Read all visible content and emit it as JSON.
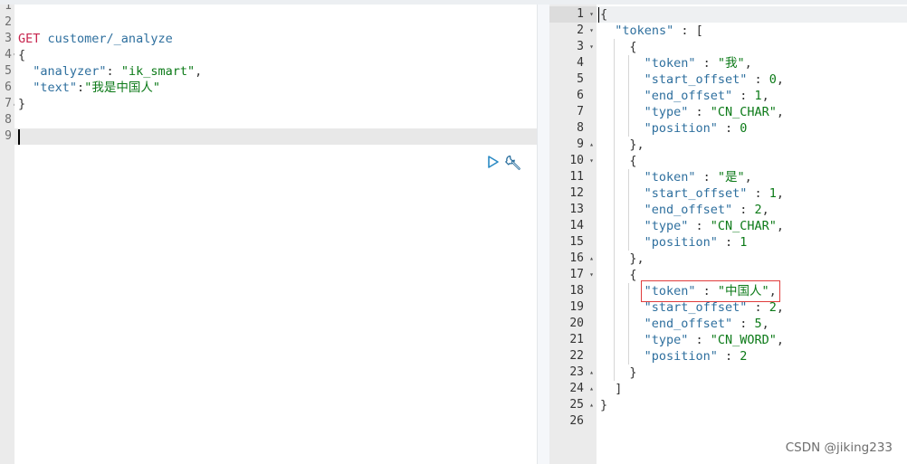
{
  "request": {
    "line_numbers": [
      "1",
      "2",
      "3",
      "4",
      "5",
      "6",
      "7",
      "8",
      "9"
    ],
    "lines": [
      {
        "n": 3,
        "parts": [
          [
            "method",
            "GET"
          ],
          [
            "punc",
            " "
          ],
          [
            "url",
            "customer/_analyze"
          ]
        ]
      },
      {
        "n": 4,
        "parts": [
          [
            "punc",
            "{"
          ]
        ]
      },
      {
        "n": 5,
        "parts": [
          [
            "punc",
            "  "
          ],
          [
            "key",
            "\"analyzer\""
          ],
          [
            "punc",
            ": "
          ],
          [
            "str",
            "\"ik_smart\""
          ],
          [
            "punc",
            ","
          ]
        ]
      },
      {
        "n": 6,
        "parts": [
          [
            "punc",
            "  "
          ],
          [
            "key",
            "\"text\""
          ],
          [
            "punc",
            ":"
          ],
          [
            "str",
            "\"我是中国人\""
          ]
        ]
      },
      {
        "n": 7,
        "parts": [
          [
            "punc",
            "}"
          ]
        ]
      }
    ],
    "active_line": 9,
    "fold_lines": [
      4,
      7
    ]
  },
  "toolbar": {
    "run_icon": "play-triangle-icon",
    "settings_icon": "wrench-icon"
  },
  "response": {
    "line_count": 26,
    "active_line": 1,
    "fold_down": [
      1,
      2,
      3,
      10,
      17
    ],
    "fold_up": [
      9,
      16,
      23,
      24,
      25
    ],
    "lines": [
      {
        "n": 1,
        "i": 0,
        "parts": [
          [
            "punc",
            "{"
          ]
        ]
      },
      {
        "n": 2,
        "i": 1,
        "parts": [
          [
            "key",
            "\"tokens\""
          ],
          [
            "punc",
            " : ["
          ]
        ]
      },
      {
        "n": 3,
        "i": 2,
        "parts": [
          [
            "punc",
            "{"
          ]
        ]
      },
      {
        "n": 4,
        "i": 3,
        "parts": [
          [
            "key",
            "\"token\""
          ],
          [
            "punc",
            " : "
          ],
          [
            "str",
            "\"我\""
          ],
          [
            "punc",
            ","
          ]
        ]
      },
      {
        "n": 5,
        "i": 3,
        "parts": [
          [
            "key",
            "\"start_offset\""
          ],
          [
            "punc",
            " : "
          ],
          [
            "num",
            "0"
          ],
          [
            "punc",
            ","
          ]
        ]
      },
      {
        "n": 6,
        "i": 3,
        "parts": [
          [
            "key",
            "\"end_offset\""
          ],
          [
            "punc",
            " : "
          ],
          [
            "num",
            "1"
          ],
          [
            "punc",
            ","
          ]
        ]
      },
      {
        "n": 7,
        "i": 3,
        "parts": [
          [
            "key",
            "\"type\""
          ],
          [
            "punc",
            " : "
          ],
          [
            "str",
            "\"CN_CHAR\""
          ],
          [
            "punc",
            ","
          ]
        ]
      },
      {
        "n": 8,
        "i": 3,
        "parts": [
          [
            "key",
            "\"position\""
          ],
          [
            "punc",
            " : "
          ],
          [
            "num",
            "0"
          ]
        ]
      },
      {
        "n": 9,
        "i": 2,
        "parts": [
          [
            "punc",
            "},"
          ]
        ]
      },
      {
        "n": 10,
        "i": 2,
        "parts": [
          [
            "punc",
            "{"
          ]
        ]
      },
      {
        "n": 11,
        "i": 3,
        "parts": [
          [
            "key",
            "\"token\""
          ],
          [
            "punc",
            " : "
          ],
          [
            "str",
            "\"是\""
          ],
          [
            "punc",
            ","
          ]
        ]
      },
      {
        "n": 12,
        "i": 3,
        "parts": [
          [
            "key",
            "\"start_offset\""
          ],
          [
            "punc",
            " : "
          ],
          [
            "num",
            "1"
          ],
          [
            "punc",
            ","
          ]
        ]
      },
      {
        "n": 13,
        "i": 3,
        "parts": [
          [
            "key",
            "\"end_offset\""
          ],
          [
            "punc",
            " : "
          ],
          [
            "num",
            "2"
          ],
          [
            "punc",
            ","
          ]
        ]
      },
      {
        "n": 14,
        "i": 3,
        "parts": [
          [
            "key",
            "\"type\""
          ],
          [
            "punc",
            " : "
          ],
          [
            "str",
            "\"CN_CHAR\""
          ],
          [
            "punc",
            ","
          ]
        ]
      },
      {
        "n": 15,
        "i": 3,
        "parts": [
          [
            "key",
            "\"position\""
          ],
          [
            "punc",
            " : "
          ],
          [
            "num",
            "1"
          ]
        ]
      },
      {
        "n": 16,
        "i": 2,
        "parts": [
          [
            "punc",
            "},"
          ]
        ]
      },
      {
        "n": 17,
        "i": 2,
        "parts": [
          [
            "punc",
            "{"
          ]
        ]
      },
      {
        "n": 18,
        "i": 3,
        "parts": [
          [
            "key",
            "\"token\""
          ],
          [
            "punc",
            " : "
          ],
          [
            "str",
            "\"中国人\""
          ],
          [
            "punc",
            ","
          ]
        ]
      },
      {
        "n": 19,
        "i": 3,
        "parts": [
          [
            "key",
            "\"start_offset\""
          ],
          [
            "punc",
            " : "
          ],
          [
            "num",
            "2"
          ],
          [
            "punc",
            ","
          ]
        ]
      },
      {
        "n": 20,
        "i": 3,
        "parts": [
          [
            "key",
            "\"end_offset\""
          ],
          [
            "punc",
            " : "
          ],
          [
            "num",
            "5"
          ],
          [
            "punc",
            ","
          ]
        ]
      },
      {
        "n": 21,
        "i": 3,
        "parts": [
          [
            "key",
            "\"type\""
          ],
          [
            "punc",
            " : "
          ],
          [
            "str",
            "\"CN_WORD\""
          ],
          [
            "punc",
            ","
          ]
        ]
      },
      {
        "n": 22,
        "i": 3,
        "parts": [
          [
            "key",
            "\"position\""
          ],
          [
            "punc",
            " : "
          ],
          [
            "num",
            "2"
          ]
        ]
      },
      {
        "n": 23,
        "i": 2,
        "parts": [
          [
            "punc",
            "}"
          ]
        ]
      },
      {
        "n": 24,
        "i": 1,
        "parts": [
          [
            "punc",
            "]"
          ]
        ]
      },
      {
        "n": 25,
        "i": 0,
        "parts": [
          [
            "punc",
            "}"
          ]
        ]
      }
    ],
    "highlighted_line": 18
  },
  "watermark": "CSDN @jiking233",
  "colors": {
    "method": "#c7254e",
    "key": "#2e6f9e",
    "string": "#0c7a18",
    "highlight_box": "#e03c3c"
  }
}
